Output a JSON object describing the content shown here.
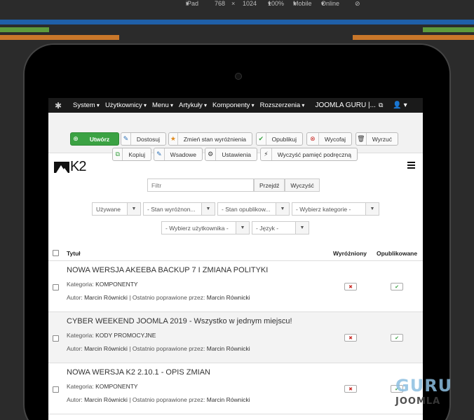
{
  "devtools": {
    "device": "iPad",
    "width": "768",
    "times": "×",
    "height": "1024",
    "zoom": "100%",
    "network": "Mobile",
    "online": "Online"
  },
  "media_bar_colors": {
    "blue": "#1f5fa8",
    "green": "#5d9b3b",
    "orange": "#c9772a"
  },
  "nav": {
    "items": [
      "System",
      "Użytkownicy",
      "Menu",
      "Artykuły",
      "Komponenty",
      "Rozszerzenia"
    ],
    "site": "JOOMLA GURU |..."
  },
  "toolbar": {
    "new": "Utwórz",
    "edit": "Dostosuj",
    "feature": "Zmień stan wyróżnienia",
    "publish": "Opublikuj",
    "unpublish": "Wycofaj",
    "trash": "Wyrzuć",
    "copy": "Kopiuj",
    "batch": "Wsadowe",
    "options": "Ustawienia",
    "clear_cache": "Wyczyść pamięć podręczną"
  },
  "brand": {
    "text": "K2"
  },
  "filters": {
    "search_placeholder": "Filtr",
    "go": "Przejdź",
    "reset": "Wyczyść",
    "used": "Używane",
    "featured": "- Stan wyróżnon...",
    "published": "- Stan opublikow...",
    "category": "- Wybierz kategorie -",
    "user": "- Wybierz użytkownika -",
    "language": "- Język -"
  },
  "table": {
    "col_title": "Tytuł",
    "col_featured": "Wyróżniony",
    "col_published": "Opublikowane",
    "category_label": "Kategoria:",
    "author_label": "Autor:",
    "modified_label": "| Ostatnio poprawione przez:",
    "rows": [
      {
        "title": "NOWA WERSJA AKEEBA BACKUP 7 I ZMIANA POLITYKI",
        "category": "KOMPONENTY",
        "author": "Marcin Równicki",
        "modified_by": "Marcin Równicki"
      },
      {
        "title": "CYBER WEEKEND JOOMLA 2019 - Wszystko w jednym miejscu!",
        "category": "KODY PROMOCYJNE",
        "author": "Marcin Równicki",
        "modified_by": "Marcin Równicki"
      },
      {
        "title": "NOWA WERSJA K2 2.10.1 - OPIS ZMIAN",
        "category": "KOMPONENTY",
        "author": "Marcin Równicki",
        "modified_by": "Marcin Równicki"
      }
    ]
  },
  "watermark": {
    "line1": "GURU",
    "line2": "JOOMLA"
  }
}
